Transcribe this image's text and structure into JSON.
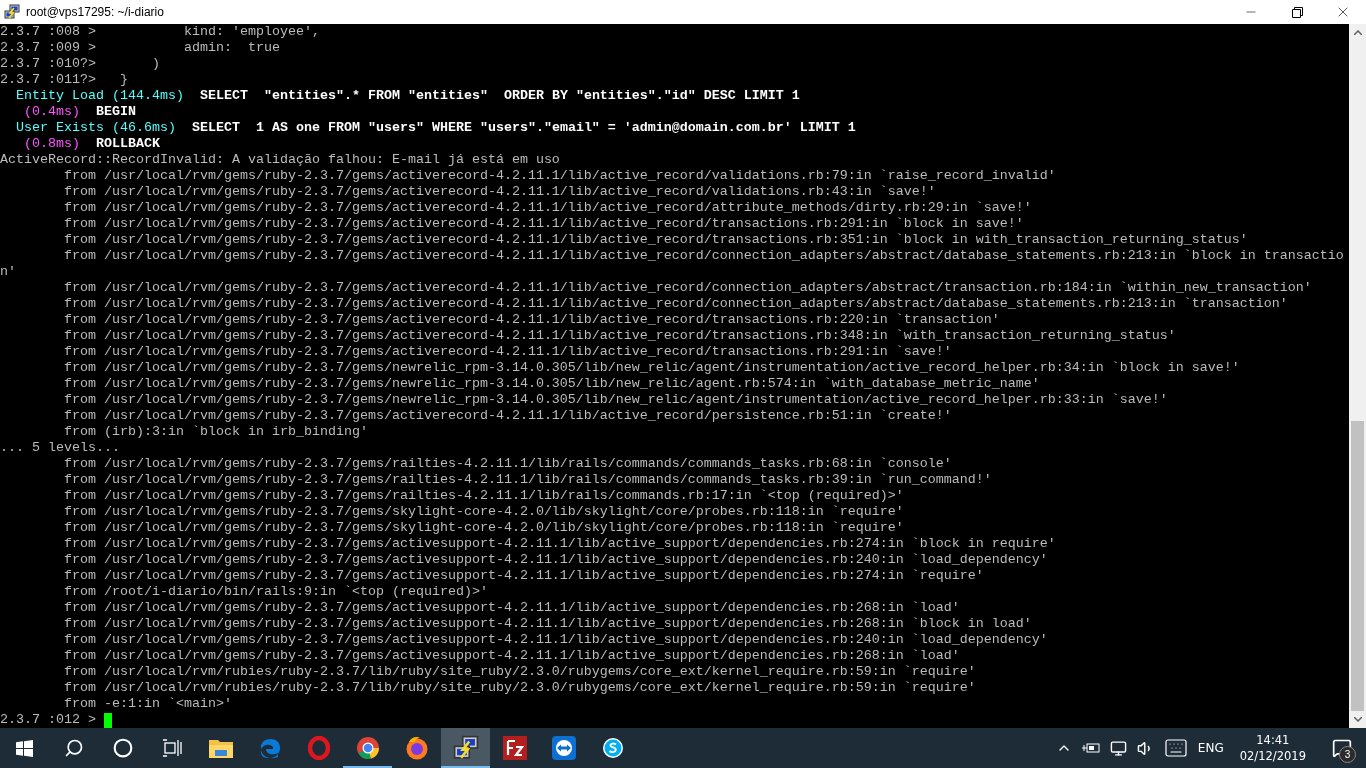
{
  "window": {
    "title": "root@vps17295: ~/i-diario"
  },
  "terminal": {
    "cursor_visible": true,
    "lines": [
      {
        "text": "2.3.7 :008 >           kind: 'employee',"
      },
      {
        "text": "2.3.7 :009 >           admin:  true"
      },
      {
        "text": "2.3.7 :010?>       )"
      },
      {
        "text": "2.3.7 :011?>   }"
      },
      {
        "segments": [
          {
            "kind": "log",
            "text": "  Entity Load (144.4ms)"
          },
          {
            "kind": "sql",
            "text": "  SELECT  \"entities\".* FROM \"entities\"  ORDER BY \"entities\".\"id\" DESC LIMIT 1"
          }
        ]
      },
      {
        "segments": [
          {
            "kind": "timing",
            "text": "   (0.4ms)"
          },
          {
            "kind": "sql",
            "text": "  BEGIN"
          }
        ]
      },
      {
        "segments": [
          {
            "kind": "log",
            "text": "  User Exists (46.6ms)"
          },
          {
            "kind": "sql",
            "text": "  SELECT  1 AS one FROM \"users\" WHERE \"users\".\"email\" = 'admin@domain.com.br' LIMIT 1"
          }
        ]
      },
      {
        "segments": [
          {
            "kind": "timing",
            "text": "   (0.8ms)"
          },
          {
            "kind": "sql",
            "text": "  ROLLBACK"
          }
        ]
      },
      {
        "text": "ActiveRecord::RecordInvalid: A validação falhou: E-mail já está em uso"
      },
      {
        "text": "        from /usr/local/rvm/gems/ruby-2.3.7/gems/activerecord-4.2.11.1/lib/active_record/validations.rb:79:in `raise_record_invalid'"
      },
      {
        "text": "        from /usr/local/rvm/gems/ruby-2.3.7/gems/activerecord-4.2.11.1/lib/active_record/validations.rb:43:in `save!'"
      },
      {
        "text": "        from /usr/local/rvm/gems/ruby-2.3.7/gems/activerecord-4.2.11.1/lib/active_record/attribute_methods/dirty.rb:29:in `save!'"
      },
      {
        "text": "        from /usr/local/rvm/gems/ruby-2.3.7/gems/activerecord-4.2.11.1/lib/active_record/transactions.rb:291:in `block in save!'"
      },
      {
        "text": "        from /usr/local/rvm/gems/ruby-2.3.7/gems/activerecord-4.2.11.1/lib/active_record/transactions.rb:351:in `block in with_transaction_returning_status'"
      },
      {
        "text": "        from /usr/local/rvm/gems/ruby-2.3.7/gems/activerecord-4.2.11.1/lib/active_record/connection_adapters/abstract/database_statements.rb:213:in `block in transactio"
      },
      {
        "text": "n'"
      },
      {
        "text": "        from /usr/local/rvm/gems/ruby-2.3.7/gems/activerecord-4.2.11.1/lib/active_record/connection_adapters/abstract/transaction.rb:184:in `within_new_transaction'"
      },
      {
        "text": "        from /usr/local/rvm/gems/ruby-2.3.7/gems/activerecord-4.2.11.1/lib/active_record/connection_adapters/abstract/database_statements.rb:213:in `transaction'"
      },
      {
        "text": "        from /usr/local/rvm/gems/ruby-2.3.7/gems/activerecord-4.2.11.1/lib/active_record/transactions.rb:220:in `transaction'"
      },
      {
        "text": "        from /usr/local/rvm/gems/ruby-2.3.7/gems/activerecord-4.2.11.1/lib/active_record/transactions.rb:348:in `with_transaction_returning_status'"
      },
      {
        "text": "        from /usr/local/rvm/gems/ruby-2.3.7/gems/activerecord-4.2.11.1/lib/active_record/transactions.rb:291:in `save!'"
      },
      {
        "text": "        from /usr/local/rvm/gems/ruby-2.3.7/gems/newrelic_rpm-3.14.0.305/lib/new_relic/agent/instrumentation/active_record_helper.rb:34:in `block in save!'"
      },
      {
        "text": "        from /usr/local/rvm/gems/ruby-2.3.7/gems/newrelic_rpm-3.14.0.305/lib/new_relic/agent.rb:574:in `with_database_metric_name'"
      },
      {
        "text": "        from /usr/local/rvm/gems/ruby-2.3.7/gems/newrelic_rpm-3.14.0.305/lib/new_relic/agent/instrumentation/active_record_helper.rb:33:in `save!'"
      },
      {
        "text": "        from /usr/local/rvm/gems/ruby-2.3.7/gems/activerecord-4.2.11.1/lib/active_record/persistence.rb:51:in `create!'"
      },
      {
        "text": "        from (irb):3:in `block in irb_binding'"
      },
      {
        "text": "... 5 levels..."
      },
      {
        "text": "        from /usr/local/rvm/gems/ruby-2.3.7/gems/railties-4.2.11.1/lib/rails/commands/commands_tasks.rb:68:in `console'"
      },
      {
        "text": "        from /usr/local/rvm/gems/ruby-2.3.7/gems/railties-4.2.11.1/lib/rails/commands/commands_tasks.rb:39:in `run_command!'"
      },
      {
        "text": "        from /usr/local/rvm/gems/ruby-2.3.7/gems/railties-4.2.11.1/lib/rails/commands.rb:17:in `<top (required)>'"
      },
      {
        "text": "        from /usr/local/rvm/gems/ruby-2.3.7/gems/skylight-core-4.2.0/lib/skylight/core/probes.rb:118:in `require'"
      },
      {
        "text": "        from /usr/local/rvm/gems/ruby-2.3.7/gems/skylight-core-4.2.0/lib/skylight/core/probes.rb:118:in `require'"
      },
      {
        "text": "        from /usr/local/rvm/gems/ruby-2.3.7/gems/activesupport-4.2.11.1/lib/active_support/dependencies.rb:274:in `block in require'"
      },
      {
        "text": "        from /usr/local/rvm/gems/ruby-2.3.7/gems/activesupport-4.2.11.1/lib/active_support/dependencies.rb:240:in `load_dependency'"
      },
      {
        "text": "        from /usr/local/rvm/gems/ruby-2.3.7/gems/activesupport-4.2.11.1/lib/active_support/dependencies.rb:274:in `require'"
      },
      {
        "text": "        from /root/i-diario/bin/rails:9:in `<top (required)>'"
      },
      {
        "text": "        from /usr/local/rvm/gems/ruby-2.3.7/gems/activesupport-4.2.11.1/lib/active_support/dependencies.rb:268:in `load'"
      },
      {
        "text": "        from /usr/local/rvm/gems/ruby-2.3.7/gems/activesupport-4.2.11.1/lib/active_support/dependencies.rb:268:in `block in load'"
      },
      {
        "text": "        from /usr/local/rvm/gems/ruby-2.3.7/gems/activesupport-4.2.11.1/lib/active_support/dependencies.rb:240:in `load_dependency'"
      },
      {
        "text": "        from /usr/local/rvm/gems/ruby-2.3.7/gems/activesupport-4.2.11.1/lib/active_support/dependencies.rb:268:in `load'"
      },
      {
        "text": "        from /usr/local/rvm/rubies/ruby-2.3.7/lib/ruby/site_ruby/2.3.0/rubygems/core_ext/kernel_require.rb:59:in `require'"
      },
      {
        "text": "        from /usr/local/rvm/rubies/ruby-2.3.7/lib/ruby/site_ruby/2.3.0/rubygems/core_ext/kernel_require.rb:59:in `require'"
      },
      {
        "text": "        from -e:1:in `<main>'"
      },
      {
        "text": "2.3.7 :012 > "
      }
    ]
  },
  "taskbar": {
    "buttons": [
      {
        "kind": "start",
        "running": false,
        "selected": false
      },
      {
        "kind": "search",
        "running": false,
        "selected": false
      },
      {
        "kind": "cortana",
        "running": false,
        "selected": false
      },
      {
        "kind": "task-view",
        "running": false,
        "selected": false
      },
      {
        "kind": "explorer",
        "running": false,
        "selected": false
      },
      {
        "kind": "edge",
        "running": false,
        "selected": false
      },
      {
        "kind": "opera",
        "running": false,
        "selected": false
      },
      {
        "kind": "chrome",
        "running": true,
        "selected": false
      },
      {
        "kind": "firefox",
        "running": false,
        "selected": false
      },
      {
        "kind": "putty",
        "running": true,
        "selected": true
      },
      {
        "kind": "filezilla",
        "running": false,
        "selected": false
      },
      {
        "kind": "teamviewer",
        "running": false,
        "selected": false
      },
      {
        "kind": "skype",
        "running": false,
        "selected": false
      }
    ],
    "tray": {
      "language": "ENG",
      "time": "14:41",
      "date": "02/12/2019",
      "notification_count": "3"
    }
  }
}
